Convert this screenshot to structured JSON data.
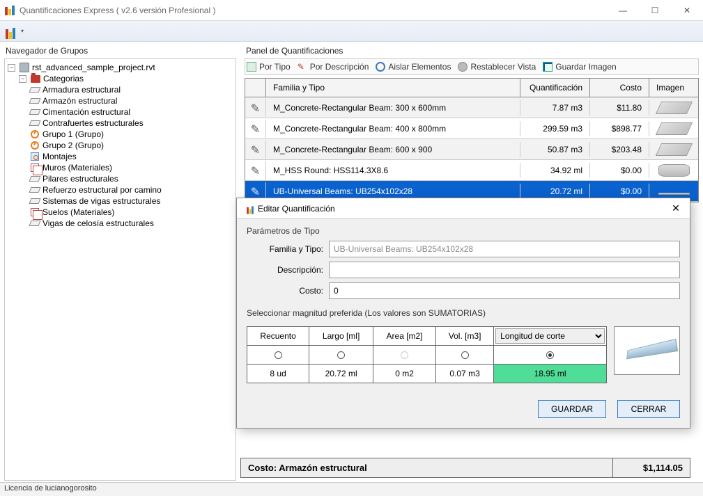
{
  "app": {
    "title": "Quantificaciones Express ( v2.6 versión Profesional )"
  },
  "toolbar": {
    "dropdown_hint": "▾"
  },
  "navigator": {
    "title": "Navegador de Grupos",
    "root": "rst_advanced_sample_project.rvt",
    "categories_label": "Categorias",
    "items": [
      "Armadura estructural",
      "Armazón estructural",
      "Cimentación estructural",
      "Contrafuertes estructurales",
      "Grupo 1 (Grupo)",
      "Grupo 2 (Grupo)",
      "Montajes",
      "Muros (Materiales)",
      "Pilares estructurales",
      "Refuerzo estructural  por camino",
      "Sistemas de vigas estructurales",
      "Suelos (Materiales)",
      "Vigas de celosía estructurales"
    ]
  },
  "panel": {
    "title": "Panel de Quantificaciones",
    "toolbar": {
      "tipo": "Por Tipo",
      "desc": "Por Descripción",
      "aislar": "Aislar Elementos",
      "restab": "Restablecer Vista",
      "imagen": "Guardar Imagen"
    },
    "columns": {
      "ft": "Familia y Tipo",
      "q": "Quantificación",
      "c": "Costo",
      "img": "Imagen"
    },
    "rows": [
      {
        "ft": "M_Concrete-Rectangular Beam: 300 x 600mm",
        "q": "7.87 m3",
        "c": "$11.80",
        "th": "box"
      },
      {
        "ft": "M_Concrete-Rectangular Beam: 400 x 800mm",
        "q": "299.59 m3",
        "c": "$898.77",
        "th": "box"
      },
      {
        "ft": "M_Concrete-Rectangular Beam: 600 x 900",
        "q": "50.87 m3",
        "c": "$203.48",
        "th": "box"
      },
      {
        "ft": "M_HSS Round: HSS114.3X8.6",
        "q": "34.92 ml",
        "c": "$0.00",
        "th": "round"
      },
      {
        "ft": "UB-Universal Beams: UB254x102x28",
        "q": "20.72 ml",
        "c": "$0.00",
        "th": "flat",
        "selected": true
      }
    ],
    "total_label": "Costo: Armazón estructural",
    "total_value": "$1,114.05"
  },
  "dialog": {
    "title": "Editar Quantificación",
    "section1": "Parámetros de Tipo",
    "labels": {
      "ft": "Familia y Tipo:",
      "desc": "Descripción:",
      "cost": "Costo:"
    },
    "values": {
      "ft": "UB-Universal Beams: UB254x102x28",
      "desc": "",
      "cost": "0"
    },
    "section2": "Seleccionar magnitud preferida (Los valores son SUMATORIAS)",
    "mag_headers": {
      "cnt": "Recuento",
      "len": "Largo [ml]",
      "area": "Area [m2]",
      "vol": "Vol. [m3]",
      "magsel": "Longitud de corte"
    },
    "mag_values": {
      "cnt": "8 ud",
      "len": "20.72 ml",
      "area": "0 m2",
      "vol": "0.07 m3",
      "magsel": "18.95 ml"
    },
    "buttons": {
      "save": "GUARDAR",
      "close": "CERRAR"
    }
  },
  "status": "Licencia de lucianogorosito"
}
